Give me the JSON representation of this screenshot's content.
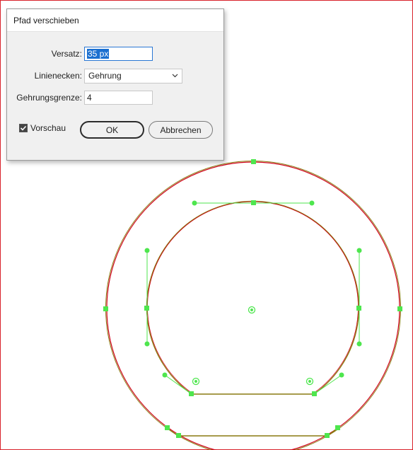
{
  "dialog": {
    "title": "Pfad verschieben",
    "offset": {
      "label": "Versatz:",
      "value": "35 px"
    },
    "joins": {
      "label": "Linienecken:",
      "value": "Gehrung"
    },
    "miter_limit": {
      "label": "Gehrungsgrenze:",
      "value": "4"
    },
    "preview": {
      "label": "Vorschau",
      "checked": true
    },
    "ok_label": "OK",
    "cancel_label": "Abbrechen"
  },
  "colors": {
    "artboard_border": "#d9222a",
    "path_original": "#d0021b",
    "path_offset": "#8a7a10",
    "anchor_green": "#4ee64e",
    "selection_blue": "#1a6fd0"
  },
  "icons": {
    "select_arrow": "chevron-down-icon",
    "checkbox_mark": "checkmark-icon",
    "center_point": "center-point-icon"
  }
}
